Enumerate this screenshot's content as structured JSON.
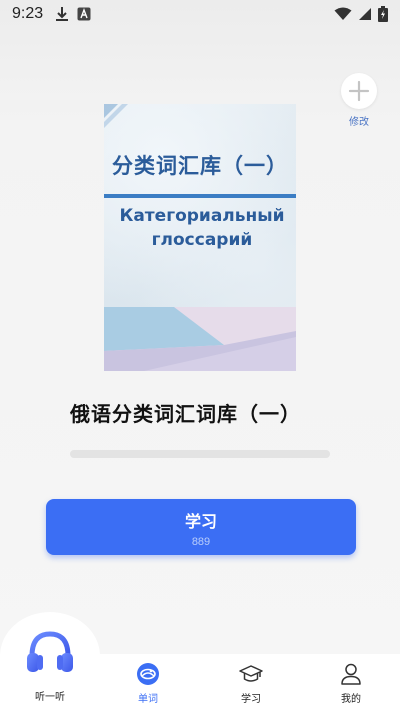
{
  "status_bar": {
    "time": "9:23",
    "left_icons": [
      "download-icon",
      "app-notification-icon"
    ],
    "right_icons": [
      "wifi-icon",
      "cellular-signal-icon",
      "battery-charging-icon"
    ]
  },
  "edit": {
    "label": "修改",
    "icon": "plus-icon"
  },
  "cover": {
    "title_cn": "分类词汇库（一）",
    "title_ru": "Категориальный глоссарий"
  },
  "book": {
    "title": "俄语分类词汇词库（一）",
    "progress": 0
  },
  "study_button": {
    "label": "学习",
    "count": "889"
  },
  "tabbar": {
    "tabs": [
      {
        "label": "听一听",
        "icon": "headphones-icon",
        "active": false
      },
      {
        "label": "单词",
        "icon": "book-globe-icon",
        "active": true
      },
      {
        "label": "学习",
        "icon": "graduation-cap-icon",
        "active": false
      },
      {
        "label": "我的",
        "icon": "person-icon",
        "active": false
      }
    ]
  },
  "colors": {
    "accent": "#3b6ef4",
    "cover_title": "#2b5c9a",
    "edit_label": "#4a74c4"
  }
}
